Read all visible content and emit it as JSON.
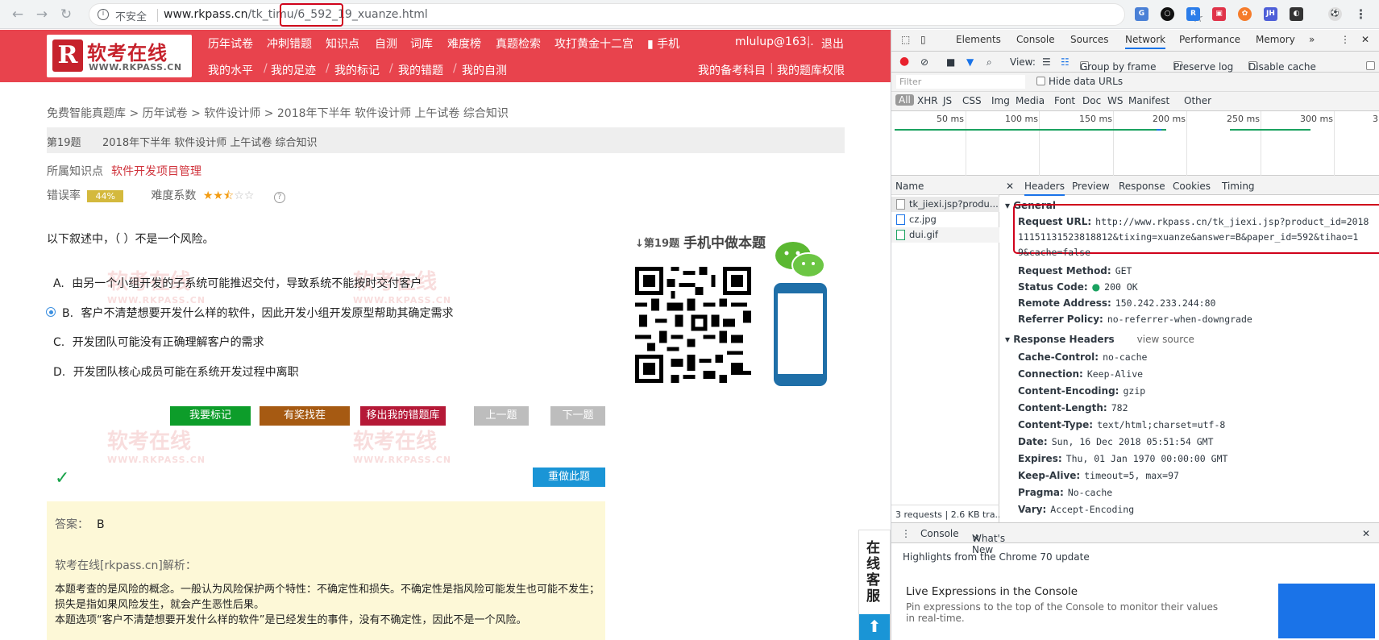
{
  "browser": {
    "insecure_label": "不安全",
    "url_host": "www.rkpass.cn",
    "url_path_a": "/tk_timu",
    "url_path_b": "/6_592_19_",
    "url_path_c": "xuanze.html",
    "extensions": [
      "translate-icon",
      "circle-icon",
      "ext-r-icon",
      "ext-gift-icon",
      "ext-orange-icon",
      "ext-jh-icon",
      "ext-mask-icon",
      "ext-ball-icon"
    ]
  },
  "site": {
    "logo_name": "软考在线",
    "logo_domain": "WWW.RKPASS.CN",
    "nav_top": [
      "历年试卷",
      "冲刺错题",
      "知识点",
      "自测",
      "词库",
      "难度榜",
      "真题检索",
      "攻打黄金十二宫",
      "手机"
    ],
    "user": "mlulup@163..",
    "logout": "退出",
    "nav_sub": [
      "我的水平",
      "我的足迹",
      "我的标记",
      "我的错题",
      "我的自测"
    ],
    "nav_sub_right": [
      "我的备考科目",
      "我的题库权限"
    ]
  },
  "question": {
    "breadcrumb": "免费智能真题库 > 历年试卷 > 软件设计师 > 2018年下半年 软件设计师 上午试卷 综合知识",
    "number": "第19题",
    "paper": "2018年下半年 软件设计师 上午试卷 综合知识",
    "kp_label": "所属知识点",
    "kp_value": "软件开发项目管理",
    "err_label": "错误率",
    "err_value": "44%",
    "difficulty_label": "难度系数",
    "difficulty_stars": 2.5,
    "stem": "以下叙述中，（ ）不是一个风险。",
    "options": [
      {
        "label": "A.",
        "text": "由另一个小组开发的子系统可能推迟交付，导致系统不能按时交付客户",
        "selected": false
      },
      {
        "label": "B.",
        "text": "客户不清楚想要开发什么样的软件，因此开发小组开发原型帮助其确定需求",
        "selected": true
      },
      {
        "label": "C.",
        "text": "开发团队可能没有正确理解客户的需求",
        "selected": false
      },
      {
        "label": "D.",
        "text": "开发团队核心成员可能在系统开发过程中离职",
        "selected": false
      }
    ],
    "buttons": {
      "mark": "我要标记",
      "bug": "有奖找茬",
      "remove": "移出我的错题库",
      "prev": "上一题",
      "next": "下一题",
      "redo": "重做此题"
    },
    "answer_label": "答案：",
    "answer_value": "B",
    "analysis_label": "软考在线[rkpass.cn]解析：",
    "analysis_1": "本题考查的是风险的概念。一般认为风险保护两个特性：不确定性和损失。不确定性是指风险可能发生也可能不发生；损失是指如果风险发生，就会产生恶性后果。",
    "analysis_2": "本题选项“客户不清楚想要开发什么样的软件”是已经发生的事件，没有不确定性，因此不是一个风险。"
  },
  "mobile_promo": {
    "number": "↓第19题",
    "text": "手机中做本题"
  },
  "kefu": "在线客服",
  "watermark": {
    "name": "软考在线",
    "domain": "WWW.RKPASS.CN"
  },
  "devtools": {
    "tabs": [
      "Elements",
      "Console",
      "Sources",
      "Network",
      "Performance",
      "Memory"
    ],
    "active_tab": "Network",
    "toolbar": {
      "view": "View:",
      "group": "Group by frame",
      "preserve": "Preserve log",
      "disable": "Disable cache"
    },
    "filter_placeholder": "Filter",
    "hide_data": "Hide data URLs",
    "types": [
      "All",
      "XHR",
      "JS",
      "CSS",
      "Img",
      "Media",
      "Font",
      "Doc",
      "WS",
      "Manifest",
      "Other"
    ],
    "timeline_ticks": [
      "50 ms",
      "100 ms",
      "150 ms",
      "200 ms",
      "250 ms",
      "300 ms",
      "3"
    ],
    "list_header": "Name",
    "requests": [
      "tk_jiexi.jsp?produ...",
      "cz.jpg",
      "dui.gif"
    ],
    "status_bar": "3 requests | 2.6 KB tra...",
    "detail_tabs": [
      "Headers",
      "Preview",
      "Response",
      "Cookies",
      "Timing"
    ],
    "general_title": "General",
    "general": [
      {
        "k": "Request URL:",
        "v": "http://www.rkpass.cn/tk_jiexi.jsp?product_id=2018"
      },
      {
        "k": "",
        "v": "11151131523818812&tixing=xuanze&answer=B&paper_id=592&tihao=1"
      },
      {
        "k": "",
        "v": "9&cache=false"
      },
      {
        "k": "Request Method:",
        "v": "GET"
      },
      {
        "k": "Status Code:",
        "v": "200 OK"
      },
      {
        "k": "Remote Address:",
        "v": "150.242.233.244:80"
      },
      {
        "k": "Referrer Policy:",
        "v": "no-referrer-when-downgrade"
      }
    ],
    "response_title": "Response Headers",
    "view_source": "view source",
    "response": [
      {
        "k": "Cache-Control:",
        "v": "no-cache"
      },
      {
        "k": "Connection:",
        "v": "Keep-Alive"
      },
      {
        "k": "Content-Encoding:",
        "v": "gzip"
      },
      {
        "k": "Content-Length:",
        "v": "782"
      },
      {
        "k": "Content-Type:",
        "v": "text/html;charset=utf-8"
      },
      {
        "k": "Date:",
        "v": "Sun, 16 Dec 2018 05:51:54 GMT"
      },
      {
        "k": "Expires:",
        "v": "Thu, 01 Jan 1970 00:00:00 GMT"
      },
      {
        "k": "Keep-Alive:",
        "v": "timeout=5, max=97"
      },
      {
        "k": "Pragma:",
        "v": "No-cache"
      },
      {
        "k": "Vary:",
        "v": "Accept-Encoding"
      }
    ],
    "drawer_tabs": [
      "Console",
      "What's New"
    ],
    "drawer_note": "Highlights from the Chrome 70 update",
    "drawer_title": "Live Expressions in the Console",
    "drawer_sub": "Pin expressions to the top of the Console to monitor their values in real-time."
  },
  "colors": {
    "brand_red": "#e8434d",
    "highlight": "#d0021b",
    "chrome_blue": "#1a73e8"
  }
}
